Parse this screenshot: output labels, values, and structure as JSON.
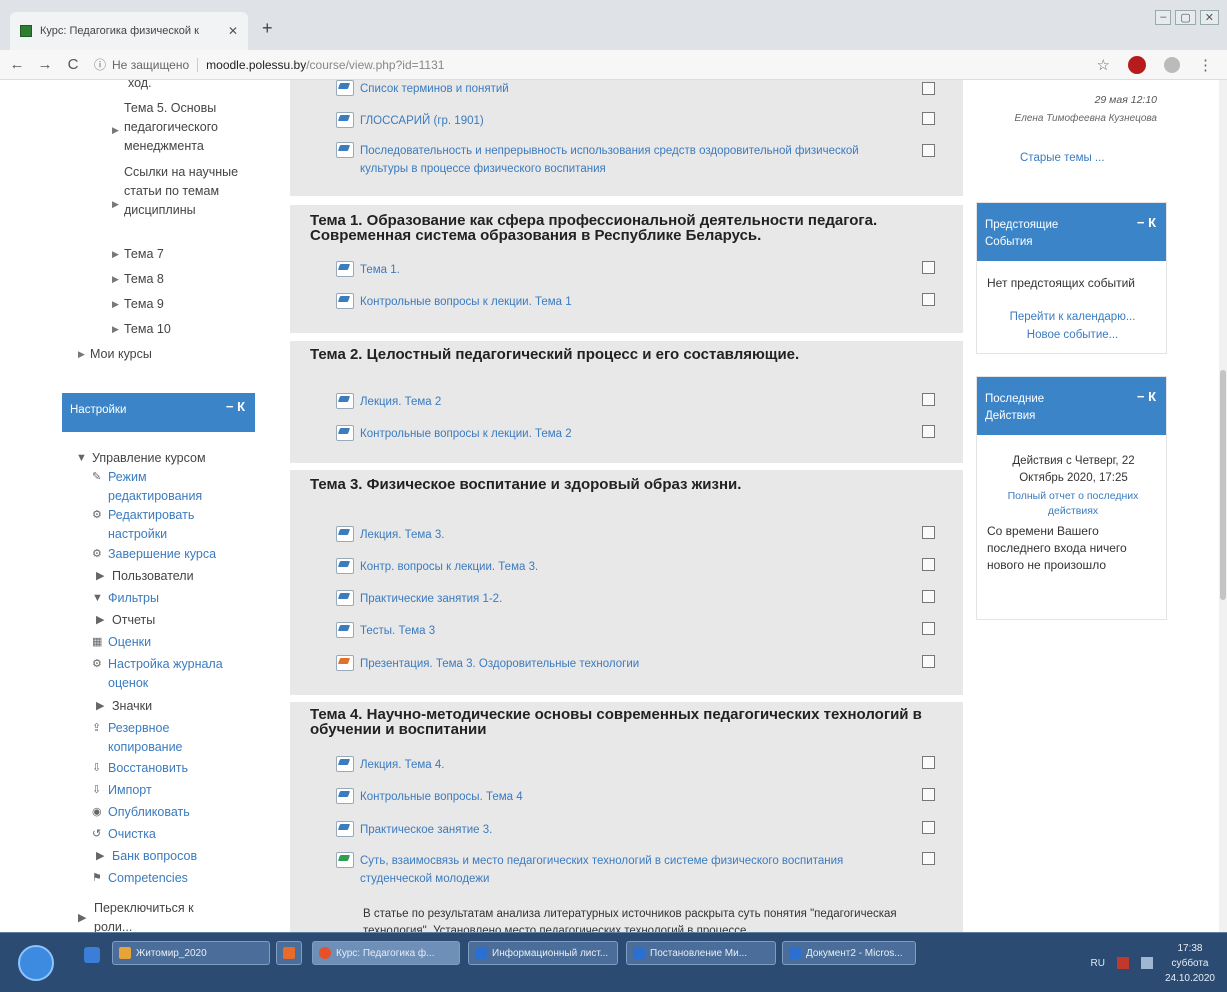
{
  "browser": {
    "tab_title": "Курс: Педагогика физической к",
    "tab_close": "✕",
    "new_tab": "+",
    "window_controls": [
      "–",
      "▢",
      "✕"
    ],
    "back": "←",
    "forward": "→",
    "reload": "C",
    "info_icon": "ⓘ",
    "insecure_label": "Не защищено",
    "url_host": "moodle.polessu.by",
    "url_path": "/course/view.php?id=1131",
    "star": "☆",
    "menu": "⋮"
  },
  "left_nav": {
    "items": [
      {
        "label": "ход.",
        "arrow": ""
      },
      {
        "label": "Тема 5. Основы педагогического менеджмента",
        "arrow": "▶"
      },
      {
        "label": "Ссылки на научные статьи по темам дисциплины",
        "arrow": "▶"
      },
      {
        "label": "Тема 7",
        "arrow": "▶"
      },
      {
        "label": "Тема 8",
        "arrow": "▶"
      },
      {
        "label": "Тема 9",
        "arrow": "▶"
      },
      {
        "label": "Тема 10",
        "arrow": "▶"
      },
      {
        "label": "Мои курсы",
        "arrow": "▶"
      }
    ]
  },
  "settings": {
    "title": "Настройки",
    "controls": "− К",
    "items": [
      {
        "label": "Управление курсом",
        "icon": "▼",
        "link": false
      },
      {
        "label": "Режим редактирования",
        "icon": "✎",
        "link": true
      },
      {
        "label": "Редактировать настройки",
        "icon": "⚙",
        "link": true
      },
      {
        "label": "Завершение курса",
        "icon": "⚙",
        "link": true
      },
      {
        "label": "Пользователи",
        "icon": "▶",
        "link": false
      },
      {
        "label": "Фильтры",
        "icon": "▼",
        "link": true
      },
      {
        "label": "Отчеты",
        "icon": "▶",
        "link": false
      },
      {
        "label": "Оценки",
        "icon": "▦",
        "link": true
      },
      {
        "label": "Настройка журнала оценок",
        "icon": "⚙",
        "link": true
      },
      {
        "label": "Значки",
        "icon": "▶",
        "link": false
      },
      {
        "label": "Резервное копирование",
        "icon": "⇪",
        "link": true
      },
      {
        "label": "Восстановить",
        "icon": "⇩",
        "link": true
      },
      {
        "label": "Импорт",
        "icon": "⇩",
        "link": true
      },
      {
        "label": "Опубликовать",
        "icon": "◉",
        "link": true
      },
      {
        "label": "Очистка",
        "icon": "↺",
        "link": true
      },
      {
        "label": "Банк вопросов",
        "icon": "▶",
        "link": true
      },
      {
        "label": "Competencies",
        "icon": "⚑",
        "link": true
      },
      {
        "label": "Переключиться к роли...",
        "icon": "▶",
        "link": false
      }
    ]
  },
  "top_section": {
    "activities": [
      {
        "label": "Список терминов и понятий"
      },
      {
        "label": "ГЛОССАРИЙ (гр. 1901)"
      },
      {
        "label": "Последовательность и непрерывность использования средств оздоровительной физической культуры в процессе физического воспитания"
      }
    ]
  },
  "sections": [
    {
      "title": "Тема 1. Образование как сфера профессиональной деятельности педагога. Современная система образования в Республике Беларусь.",
      "activities": [
        {
          "label": "Тема 1."
        },
        {
          "label": "Контрольные вопросы к лекции. Тема 1"
        }
      ]
    },
    {
      "title": "Тема 2. Целостный педагогический процесс и его составляющие.",
      "activities": [
        {
          "label": "Лекция. Тема 2"
        },
        {
          "label": "Контрольные вопросы к лекции. Тема 2"
        }
      ]
    },
    {
      "title": "Тема 3. Физическое воспитание и здоровый образ жизни.",
      "activities": [
        {
          "label": "Лекция. Тема 3."
        },
        {
          "label": "Контр. вопросы к лекции. Тема 3."
        },
        {
          "label": "Практические занятия 1-2."
        },
        {
          "label": "Тесты. Тема 3"
        },
        {
          "label": "Презентация. Тема 3. Оздоровительные технологии"
        }
      ]
    },
    {
      "title": "Тема 4. Научно-методические основы современных педагогических технологий в обучении и воспитании",
      "activities": [
        {
          "label": "Лекция. Тема 4."
        },
        {
          "label": "Контрольные вопросы. Тема 4"
        },
        {
          "label": "Практическое занятие 3."
        },
        {
          "label": "Суть, взаимосвязь и место педагогических технологий в системе физического воспитания студенческой молодежи"
        }
      ],
      "summary": "В статье по результатам анализа литературных источников раскрыта суть понятия \"педагогическая технология\". Установлено место педагогических технологий в процессе"
    }
  ],
  "right": {
    "news_date": "29 мая 12:10",
    "news_author": "Елена Тимофеевна Кузнецова",
    "old_topics": "Старые темы ...",
    "upcoming": {
      "title": "Предстоящие События",
      "controls": "− К",
      "empty": "Нет предстоящих событий",
      "calendar_link": "Перейти к календарю...",
      "new_event": "Новое событие..."
    },
    "recent": {
      "title": "Последние Действия",
      "controls": "− К",
      "since": "Действия с Четверг, 22 Октябрь 2020, 17:25",
      "full_report": "Полный отчет о последних действиях",
      "nothing": "Со времени Вашего последнего входа ничего нового не произошло"
    }
  },
  "taskbar": {
    "buttons": [
      {
        "label": "Житомир_2020",
        "color": "#e8a33a"
      },
      {
        "label": "",
        "color": "#e86b2a"
      },
      {
        "label": "Курс: Педагогика ф...",
        "color": "#e8502a"
      },
      {
        "label": "Информационный лист...",
        "color": "#2b6fd1"
      },
      {
        "label": "Постановление Ми...",
        "color": "#2b6fd1"
      },
      {
        "label": "Документ2 - Micros...",
        "color": "#2b6fd1"
      }
    ],
    "lang": "RU",
    "time": "17:38",
    "day": "суббота",
    "date": "24.10.2020"
  }
}
